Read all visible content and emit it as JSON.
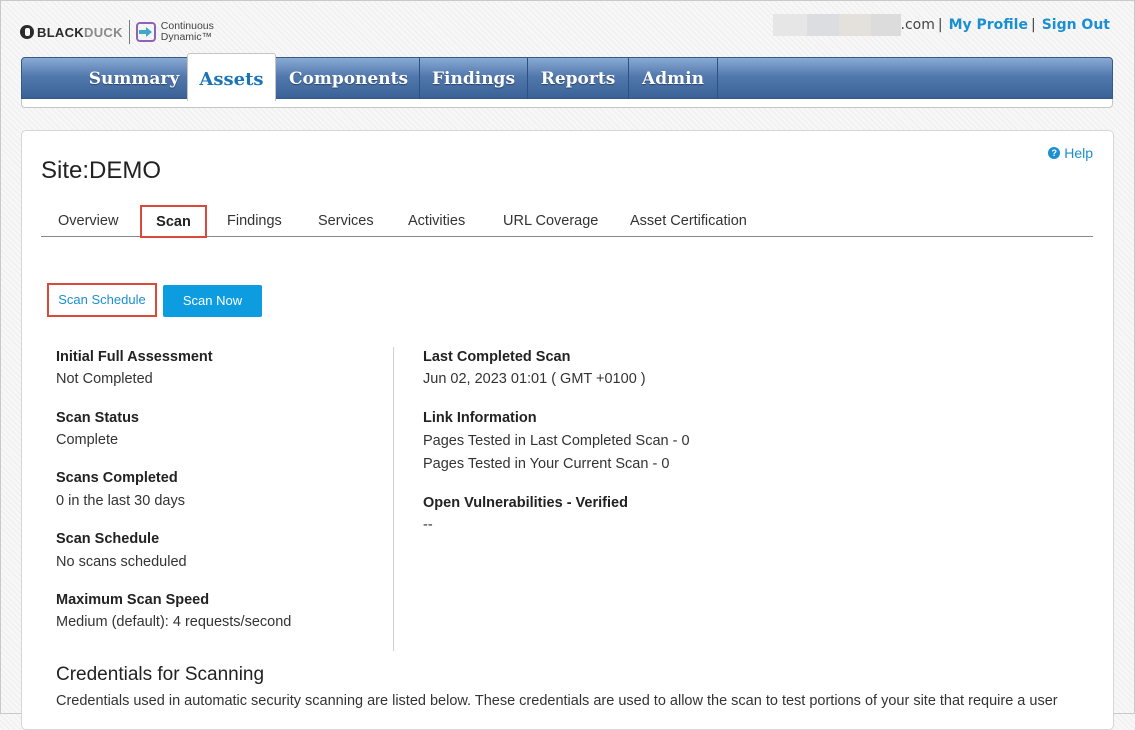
{
  "brand": {
    "blackduck_part1": "BLACK",
    "blackduck_part2": "DUCK",
    "product_line1": "Continuous",
    "product_line2": "Dynamic™"
  },
  "header": {
    "domain_suffix": ".com",
    "separator": "|",
    "my_profile": "My Profile",
    "sign_out": "Sign Out"
  },
  "nav": {
    "items": [
      "Summary",
      "Assets",
      "Components",
      "Findings",
      "Reports",
      "Admin"
    ],
    "active": "Assets"
  },
  "page": {
    "help": "Help",
    "site_label": "Site:",
    "site_name": "DEMO"
  },
  "tabs": {
    "items": [
      "Overview",
      "Scan",
      "Findings",
      "Services",
      "Activities",
      "URL Coverage",
      "Asset Certification"
    ],
    "active": "Scan"
  },
  "actions": {
    "scan_schedule": "Scan Schedule",
    "scan_now": "Scan Now"
  },
  "left_fields": [
    {
      "label": "Initial Full Assessment",
      "value": "Not Completed"
    },
    {
      "label": "Scan Status",
      "value": "Complete"
    },
    {
      "label": "Scans Completed",
      "value": "0 in the last 30 days"
    },
    {
      "label": "Scan Schedule",
      "value": "No scans scheduled"
    },
    {
      "label": "Maximum Scan Speed",
      "value": "Medium (default): 4 requests/second"
    }
  ],
  "right_fields": {
    "last_scan_label": "Last Completed Scan",
    "last_scan_value": "Jun 02, 2023 01:01 ( GMT +0100 )",
    "link_info_label": "Link Information",
    "link_info_line1": "Pages Tested in Last Completed Scan - 0",
    "link_info_line2": "Pages Tested in Your Current Scan - 0",
    "open_vuln_label": "Open Vulnerabilities - Verified",
    "open_vuln_value": "--"
  },
  "credentials": {
    "title": "Credentials for Scanning",
    "description": "Credentials used in automatic security scanning are listed below. These credentials are used to allow the scan to test portions of your site that require a user"
  },
  "colors": {
    "accent_blue": "#1b8fd1",
    "highlight_red": "#d94a3a",
    "button_blue": "#0d9ce0",
    "nav_blue": "#4a71a6"
  }
}
